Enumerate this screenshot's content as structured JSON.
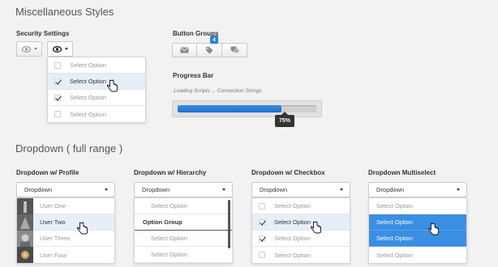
{
  "misc": {
    "title": "Miscellaneous Styles",
    "security": {
      "heading": "Security Settings",
      "eye_icon": "eye-icon",
      "options": [
        {
          "label": "Select Option",
          "checked": false,
          "active": false
        },
        {
          "label": "Select Option",
          "checked": true,
          "active": true
        },
        {
          "label": "Select Option",
          "checked": true,
          "active": false
        },
        {
          "label": "Select Option",
          "checked": false,
          "active": false
        }
      ]
    },
    "button_groups": {
      "heading": "Button Groups",
      "buttons": [
        "envelope-icon",
        "tag-icon",
        "chat-icon"
      ],
      "badge": "4"
    },
    "progress": {
      "heading": "Progress Bar",
      "status": "Loading Scripts ... Connection Strings",
      "value_label": "75%",
      "value": 0.75
    }
  },
  "dropdown": {
    "title": "Dropdown ( full range )",
    "profile": {
      "heading": "Dropdown w/ Profile",
      "select_label": "Dropdown",
      "items": [
        {
          "label": "User One",
          "active": false
        },
        {
          "label": "User Two",
          "active": true
        },
        {
          "label": "User Three",
          "active": false
        },
        {
          "label": "User Four",
          "active": false
        }
      ]
    },
    "hierarchy": {
      "heading": "Dropdown w/ Hierarchy",
      "select_label": "Dropdown",
      "items": [
        {
          "label": "Select Option"
        },
        {
          "label": "Option Group"
        },
        {
          "label": "Select Option"
        },
        {
          "label": "Select Option"
        }
      ]
    },
    "checkbox": {
      "heading": "Dropdown w/ Checkbox",
      "select_label": "Dropdown",
      "items": [
        {
          "label": "Select Option",
          "checked": false
        },
        {
          "label": "Select Option",
          "checked": true
        },
        {
          "label": "Select Option",
          "checked": true
        },
        {
          "label": "Select Option",
          "checked": false
        }
      ]
    },
    "multiselect": {
      "heading": "Dropdown Multiselect",
      "select_label": "Dropdown",
      "items": [
        {
          "label": "Select Option",
          "selected": false
        },
        {
          "label": "Select Option",
          "selected": true
        },
        {
          "label": "Select Option",
          "selected": true
        },
        {
          "label": "Select Option",
          "selected": false
        }
      ]
    }
  },
  "colors": {
    "accent": "#3a8ee4",
    "badge": "#2f7fd8",
    "tooltip": "#333333"
  }
}
